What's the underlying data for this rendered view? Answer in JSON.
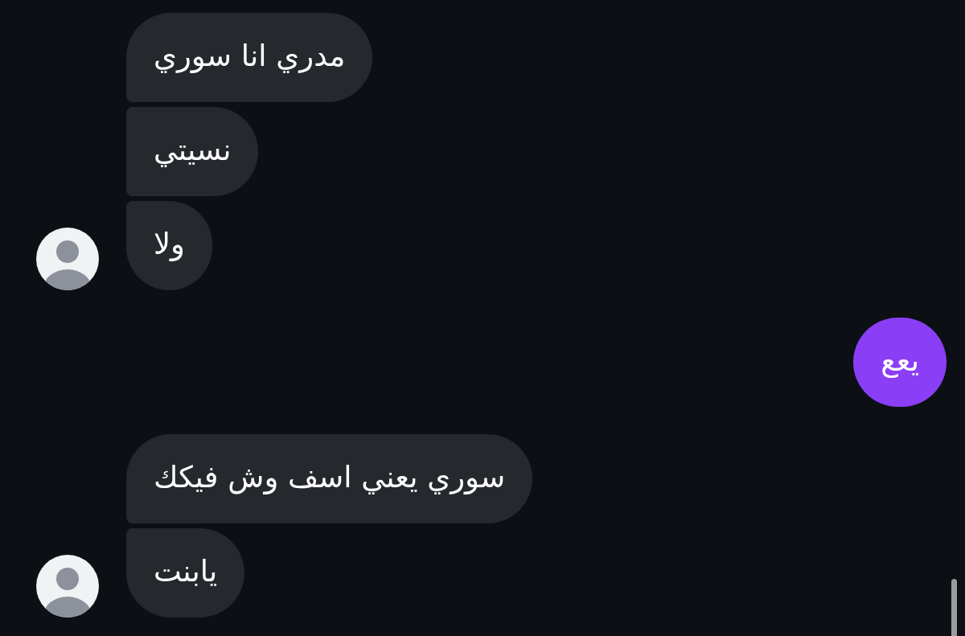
{
  "conversation": [
    {
      "kind": "received",
      "bubbles": [
        "مدري انا سوري",
        "نسيتي",
        "ولا"
      ]
    },
    {
      "kind": "sent",
      "bubbles": [
        "يعع"
      ]
    },
    {
      "kind": "received",
      "bubbles": [
        "سوري يعني اسف وش فيكك",
        "يابنت"
      ]
    }
  ]
}
